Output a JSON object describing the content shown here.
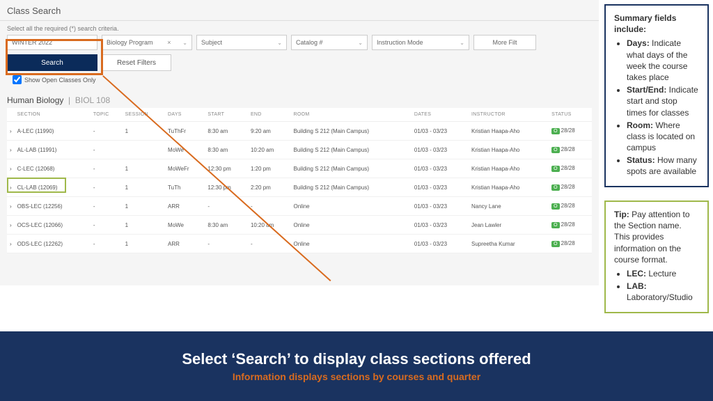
{
  "page": {
    "title": "Class Search",
    "subtitle": "Select all the required (*) search criteria."
  },
  "filters": {
    "term": "WINTER 2022",
    "org": "Biology Program",
    "subject": "Subject",
    "catalog": "Catalog #",
    "mode": "Instruction Mode",
    "more": "More Filt"
  },
  "buttons": {
    "search": "Search",
    "reset": "Reset Filters"
  },
  "checkbox": {
    "label": "Show Open Classes Only"
  },
  "results": {
    "course_name": "Human Biology",
    "course_code": "BIOL 108"
  },
  "headers": {
    "section": "SECTION",
    "topic": "TOPIC",
    "session": "SESSION",
    "days": "DAYS",
    "start": "START",
    "end": "END",
    "room": "ROOM",
    "dates": "DATES",
    "instructor": "INSTRUCTOR",
    "status": "STATUS"
  },
  "rows": [
    {
      "section": "A-LEC (11990)",
      "topic": "-",
      "session": "1",
      "days": "TuThFr",
      "start": "8:30 am",
      "end": "9:20 am",
      "room": "Building S 212 (Main Campus)",
      "dates": "01/03 - 03/23",
      "instructor": "Kristian Haapa-Aho",
      "badge": "O",
      "status": "28/28"
    },
    {
      "section": "AL-LAB (11991)",
      "topic": "-",
      "session": "",
      "days": "MoWe",
      "start": "8:30 am",
      "end": "10:20 am",
      "room": "Building S 212 (Main Campus)",
      "dates": "01/03 - 03/23",
      "instructor": "Kristian Haapa-Aho",
      "badge": "O",
      "status": "28/28"
    },
    {
      "section": "C-LEC (12068)",
      "topic": "-",
      "session": "1",
      "days": "MoWeFr",
      "start": "12:30 pm",
      "end": "1:20 pm",
      "room": "Building S 212 (Main Campus)",
      "dates": "01/03 - 03/23",
      "instructor": "Kristian Haapa-Aho",
      "badge": "O",
      "status": "28/28"
    },
    {
      "section": "CL-LAB (12069)",
      "topic": "-",
      "session": "1",
      "days": "TuTh",
      "start": "12:30 pm",
      "end": "2:20 pm",
      "room": "Building S 212 (Main Campus)",
      "dates": "01/03 - 03/23",
      "instructor": "Kristian Haapa-Aho",
      "badge": "O",
      "status": "28/28"
    },
    {
      "section": "OBS-LEC (12256)",
      "topic": "-",
      "session": "1",
      "days": "ARR",
      "start": "-",
      "end": "-",
      "room": "Online",
      "dates": "01/03 - 03/23",
      "instructor": "Nancy Lane",
      "badge": "O",
      "status": "28/28"
    },
    {
      "section": "OCS-LEC (12066)",
      "topic": "-",
      "session": "1",
      "days": "MoWe",
      "start": "8:30 am",
      "end": "10:20 am",
      "room": "Online",
      "dates": "01/03 - 03/23",
      "instructor": "Jean Lawler",
      "badge": "O",
      "status": "28/28"
    },
    {
      "section": "ODS-LEC (12262)",
      "topic": "-",
      "session": "1",
      "days": "ARR",
      "start": "-",
      "end": "-",
      "room": "Online",
      "dates": "01/03 - 03/23",
      "instructor": "Supreetha Kumar",
      "badge": "O",
      "status": "28/28"
    }
  ],
  "summary_box": {
    "title": "Summary fields include:",
    "items": [
      {
        "label": "Days:",
        "text": "Indicate what days of the week the course takes place"
      },
      {
        "label": "Start/End:",
        "text": "Indicate start and stop times for classes"
      },
      {
        "label": "Room:",
        "text": "Where class is located on campus"
      },
      {
        "label": "Status:",
        "text": "How many spots are available"
      }
    ]
  },
  "tip_box": {
    "title": "Tip:",
    "text": "Pay attention to the Section name. This provides information on the course format.",
    "items": [
      {
        "label": "LEC:",
        "text": "Lecture"
      },
      {
        "label": "LAB:",
        "text": "Laboratory/Studio"
      }
    ]
  },
  "footer": {
    "big": "Select ‘Search’ to display class sections offered",
    "small": "Information displays sections by courses and quarter"
  }
}
